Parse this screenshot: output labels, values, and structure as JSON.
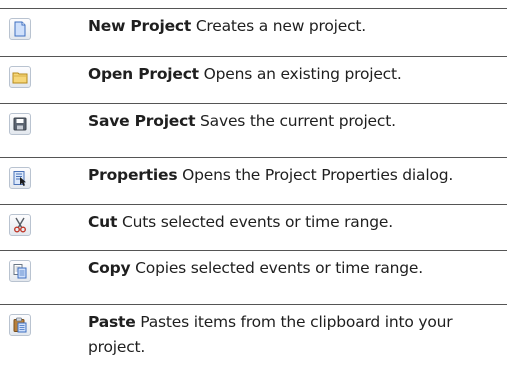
{
  "commands": [
    {
      "icon": "new-document-icon",
      "name": "New Project",
      "description": "Creates a new project."
    },
    {
      "icon": "open-folder-icon",
      "name": "Open Project",
      "description": "Opens an existing project."
    },
    {
      "icon": "save-disk-icon",
      "name": "Save Project",
      "description": "Saves the current project."
    },
    {
      "icon": "properties-icon",
      "name": "Properties",
      "description": "Opens the Project Properties dialog."
    },
    {
      "icon": "scissors-icon",
      "name": "Cut",
      "description": "Cuts selected events or time range."
    },
    {
      "icon": "copy-icon",
      "name": "Copy",
      "description": "Copies selected events or time range."
    },
    {
      "icon": "paste-clipboard-icon",
      "name": "Paste",
      "description": "Pastes items from the clipboard into your project."
    }
  ]
}
